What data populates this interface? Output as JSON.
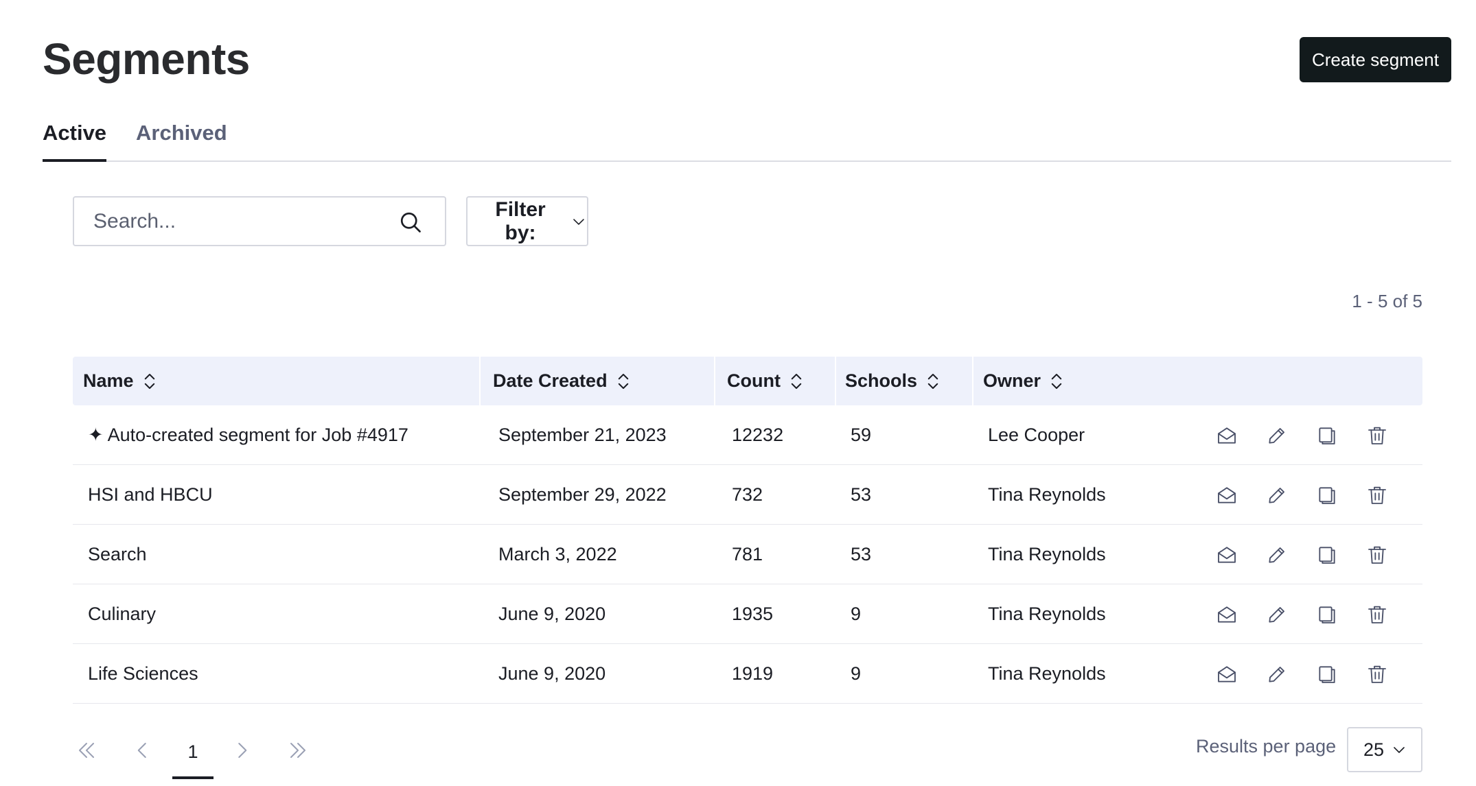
{
  "page": {
    "title": "Segments"
  },
  "header": {
    "create_label": "Create segment"
  },
  "tabs": [
    {
      "label": "Active",
      "active": true
    },
    {
      "label": "Archived",
      "active": false
    }
  ],
  "search": {
    "placeholder": "Search...",
    "value": ""
  },
  "filter": {
    "label": "Filter by:"
  },
  "range_text": "1 - 5 of 5",
  "table": {
    "columns": [
      "Name",
      "Date Created",
      "Count",
      "Schools",
      "Owner"
    ],
    "rows": [
      {
        "name": "✦ Auto-created segment for Job #4917",
        "date": "September 21, 2023",
        "count": "12232",
        "schools": "59",
        "owner": "Lee Cooper"
      },
      {
        "name": "HSI and HBCU",
        "date": "September 29, 2022",
        "count": "732",
        "schools": "53",
        "owner": "Tina Reynolds"
      },
      {
        "name": "Search",
        "date": "March 3, 2022",
        "count": "781",
        "schools": "53",
        "owner": "Tina Reynolds"
      },
      {
        "name": "Culinary",
        "date": "June 9, 2020",
        "count": "1935",
        "schools": "9",
        "owner": "Tina Reynolds"
      },
      {
        "name": "Life Sciences",
        "date": "June 9, 2020",
        "count": "1919",
        "schools": "9",
        "owner": "Tina Reynolds"
      }
    ],
    "row_actions": [
      "envelope-open-icon",
      "pencil-icon",
      "copy-icon",
      "trash-icon"
    ]
  },
  "pagination": {
    "current_page": "1",
    "results_per_page_label": "Results per page",
    "results_per_page": "25"
  },
  "colors": {
    "primary_button": "#121a1c",
    "header_bg": "#eef1fb",
    "muted_text": "#5b6178",
    "icon": "#4a5068"
  }
}
